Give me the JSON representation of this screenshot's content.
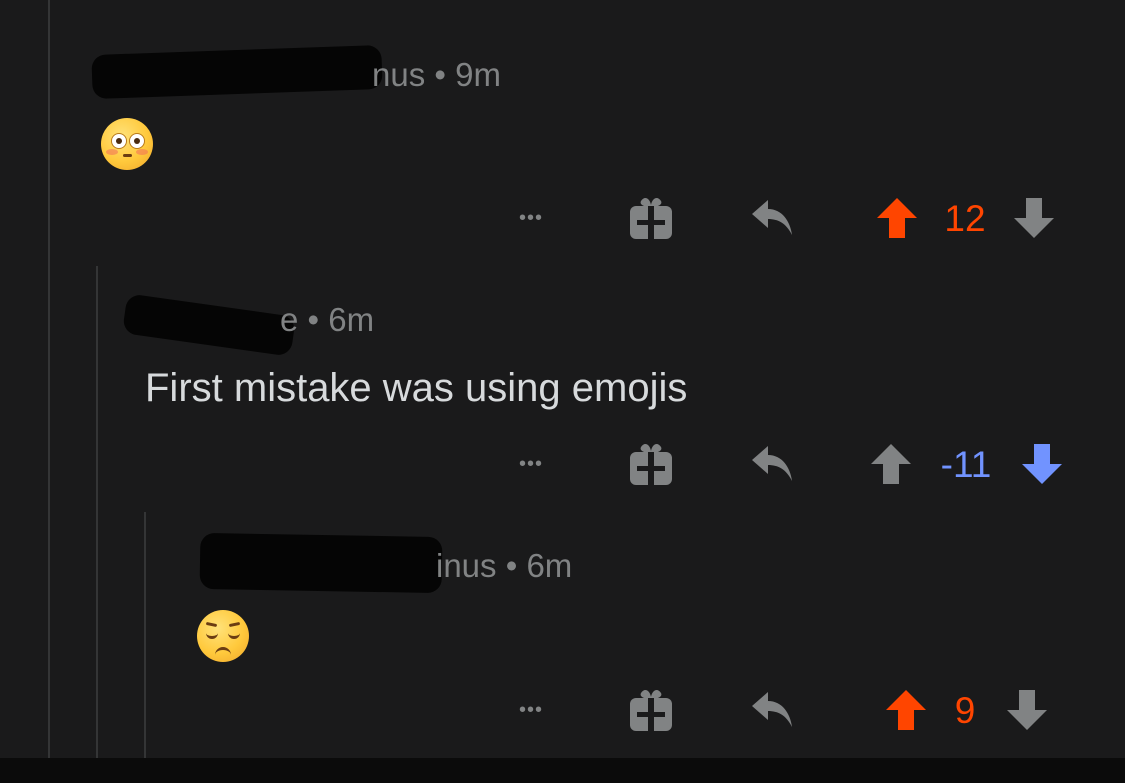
{
  "colors": {
    "background": "#1a1a1b",
    "text": "#d7dadc",
    "meta": "#818384",
    "icon": "#818384",
    "icon_dim": "#5f6164",
    "upvote": "#ff4500",
    "downvote": "#7193ff",
    "thread_line": "#343536"
  },
  "comments": [
    {
      "author_visible": "nus",
      "separator": "•",
      "time": "9m",
      "body_emoji": "flushed-face-emoji",
      "score": "12",
      "vote_state": "upvoted"
    },
    {
      "author_visible": "e",
      "separator": "•",
      "time": "6m",
      "body_text": "First mistake was using emojis",
      "score": "-11",
      "vote_state": "downvoted"
    },
    {
      "author_visible": "inus",
      "separator": "•",
      "time": "6m",
      "body_emoji": "pensive-face-emoji",
      "score": "9",
      "vote_state": "upvoted"
    }
  ],
  "actions": {
    "more": "•••",
    "icons": [
      "more-icon",
      "gift-icon",
      "reply-icon",
      "upvote-icon",
      "downvote-icon"
    ]
  }
}
